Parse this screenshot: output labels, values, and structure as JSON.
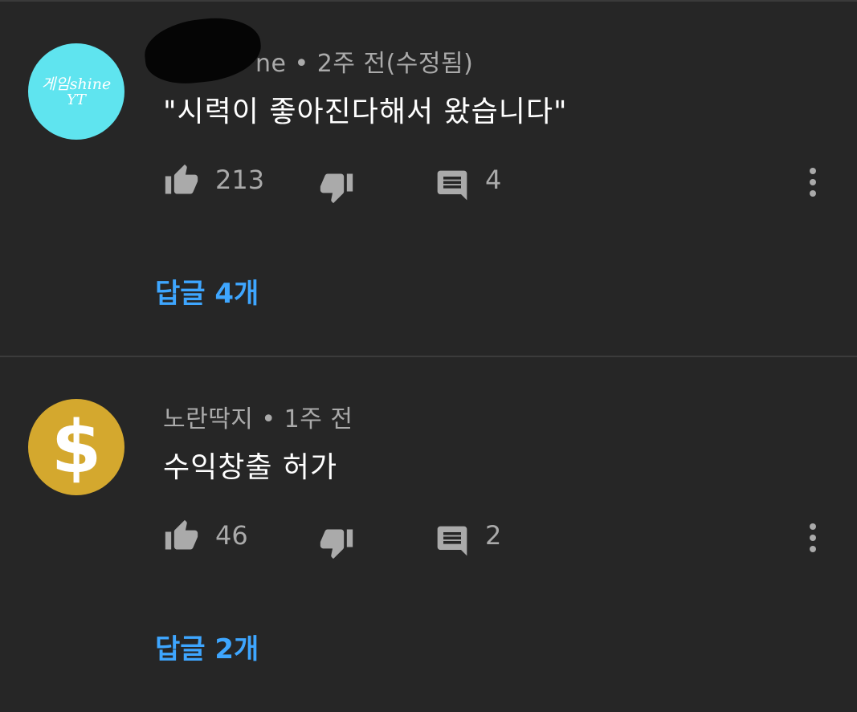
{
  "comments": [
    {
      "avatar": {
        "line1": "게임shine",
        "line2": "YT",
        "bg_color": "#5fe4ef"
      },
      "author_visible": "ne",
      "meta": "• 2주 전(수정됨)",
      "text": "\"시력이 좋아진다해서 왔습니다\"",
      "likes": "213",
      "reply_count": "4",
      "replies_link": "답글 4개",
      "icons": [
        "thumb-up-icon",
        "thumb-down-icon",
        "reply-icon",
        "more-vert-icon"
      ]
    },
    {
      "avatar": {
        "symbol": "$",
        "bg_color": "#d4a82e"
      },
      "author": "노란딱지",
      "meta": "노란딱지 • 1주 전",
      "text": "수익창출 허가",
      "likes": "46",
      "reply_count": "2",
      "replies_link": "답글 2개",
      "icons": [
        "thumb-up-icon",
        "thumb-down-icon",
        "reply-icon",
        "more-vert-icon"
      ]
    }
  ],
  "colors": {
    "background": "#262626",
    "meta_text": "#aaaaaa",
    "comment_text": "#ffffff",
    "link": "#3ea6ff",
    "icon": "#aaaaaa"
  }
}
